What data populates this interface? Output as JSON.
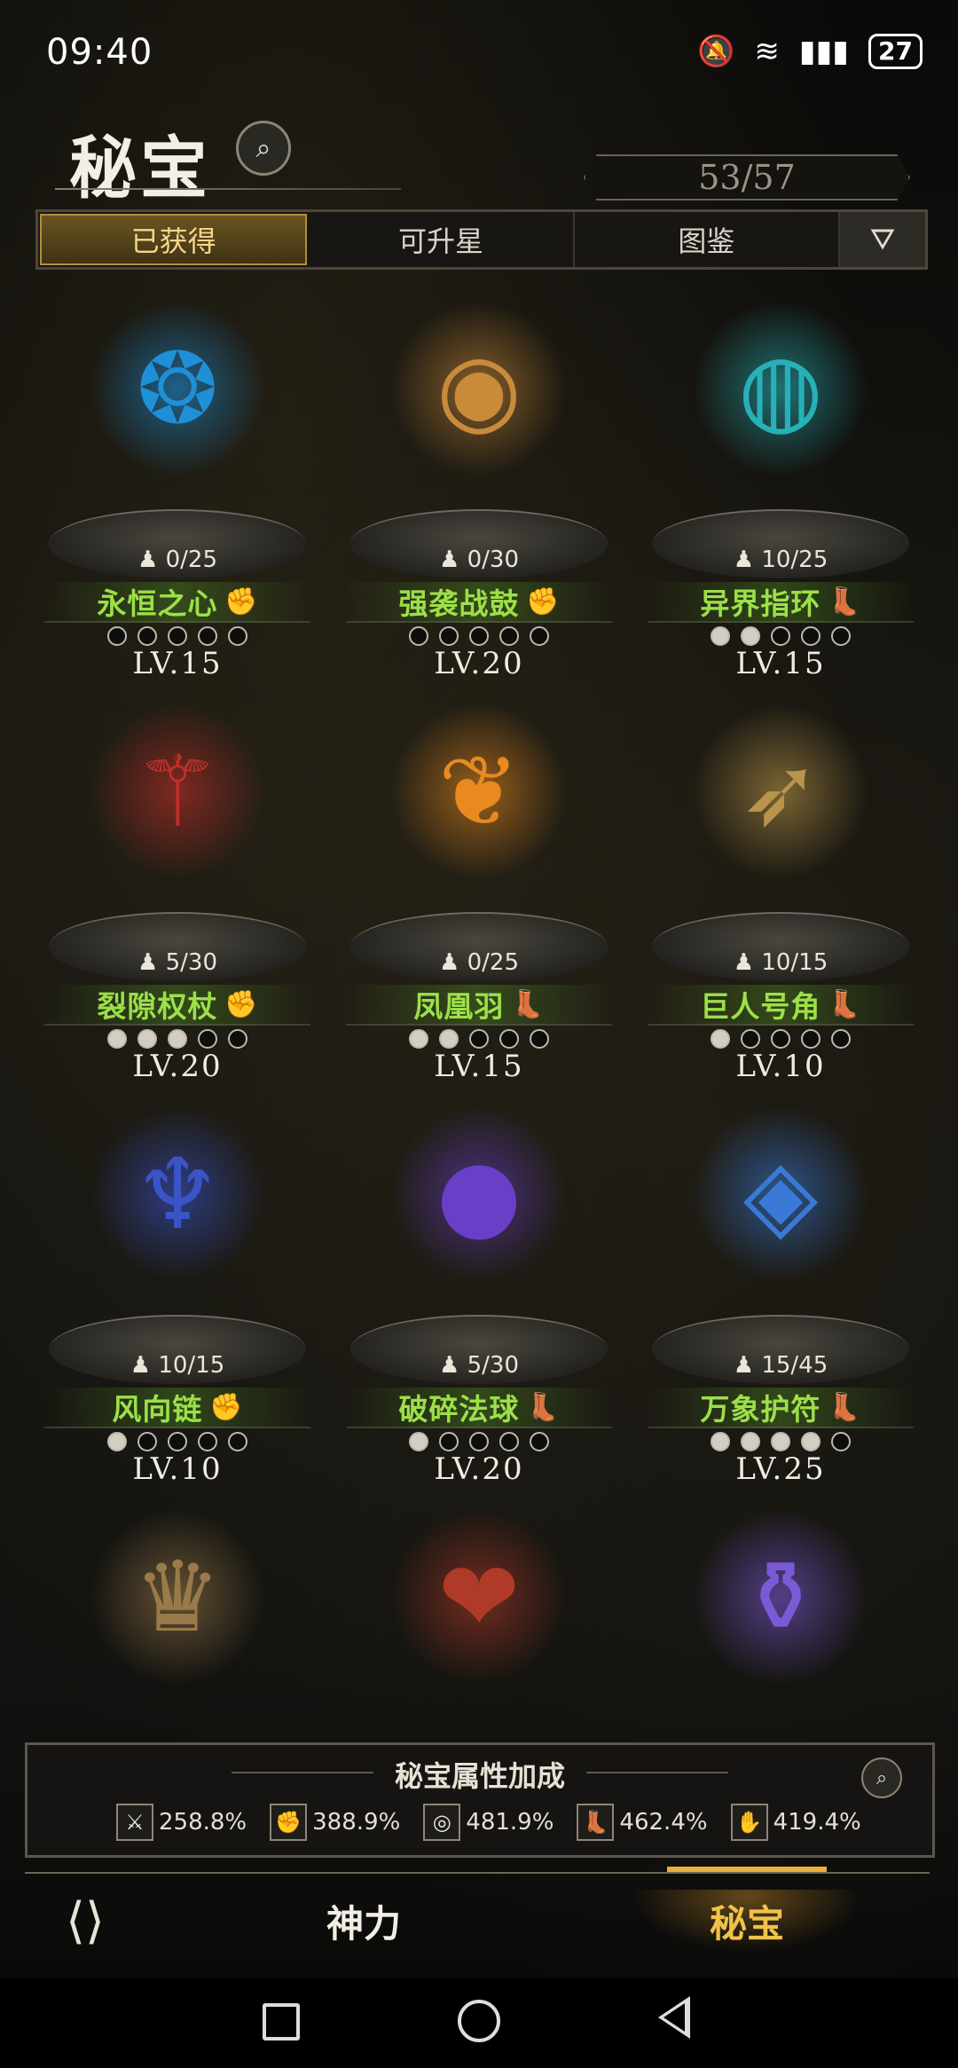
{
  "status_bar": {
    "time": "09:40",
    "battery": "27"
  },
  "header": {
    "title": "秘宝",
    "counter": "53/57"
  },
  "tabs": [
    {
      "label": "已获得",
      "active": true
    },
    {
      "label": "可升星",
      "active": false
    },
    {
      "label": "图鉴",
      "active": false
    }
  ],
  "items": [
    {
      "name": "永恒之心",
      "shards": "0/25",
      "level": "LV.15",
      "stars_on": 0,
      "icon": "heart-relic-icon",
      "type_icon": "fist-swirl-icon",
      "color": "#1f8fd6"
    },
    {
      "name": "强袭战鼓",
      "shards": "0/30",
      "level": "LV.20",
      "stars_on": 0,
      "icon": "war-drum-icon",
      "type_icon": "fist-swirl-icon",
      "color": "#c98a3a"
    },
    {
      "name": "异界指环",
      "shards": "10/25",
      "level": "LV.15",
      "stars_on": 2,
      "icon": "ring-icon",
      "type_icon": "boot-swirl-icon",
      "color": "#27b0b8"
    },
    {
      "name": "裂隙权杖",
      "shards": "5/30",
      "level": "LV.20",
      "stars_on": 3,
      "icon": "scepter-icon",
      "type_icon": "fist-swirl-icon",
      "color": "#c0302a"
    },
    {
      "name": "凤凰羽",
      "shards": "0/25",
      "level": "LV.15",
      "stars_on": 2,
      "icon": "feather-icon",
      "type_icon": "boot-icon",
      "color": "#e88a20"
    },
    {
      "name": "巨人号角",
      "shards": "10/15",
      "level": "LV.10",
      "stars_on": 1,
      "icon": "horn-icon",
      "type_icon": "boot-icon",
      "color": "#b8954a"
    },
    {
      "name": "风向链",
      "shards": "10/15",
      "level": "LV.10",
      "stars_on": 1,
      "icon": "necklace-icon",
      "type_icon": "fist-icon",
      "color": "#3a54c8"
    },
    {
      "name": "破碎法球",
      "shards": "5/30",
      "level": "LV.20",
      "stars_on": 1,
      "icon": "orb-icon",
      "type_icon": "boot-swirl-icon",
      "color": "#6a3fc8"
    },
    {
      "name": "万象护符",
      "shards": "15/45",
      "level": "LV.25",
      "stars_on": 4,
      "icon": "amulet-icon",
      "type_icon": "boot-swirl-icon",
      "color": "#3a7ad6"
    }
  ],
  "partial_items": [
    {
      "icon": "antler-crown-icon",
      "color": "#9a7a4a"
    },
    {
      "icon": "thorn-heart-icon",
      "color": "#b03a28"
    },
    {
      "icon": "potion-bottle-icon",
      "color": "#7a5ad6"
    }
  ],
  "bonus": {
    "title": "秘宝属性加成",
    "stats": [
      {
        "icon": "sword-icon",
        "value": "258.8%"
      },
      {
        "icon": "fist-icon",
        "value": "388.9%"
      },
      {
        "icon": "swirl-icon",
        "value": "481.9%"
      },
      {
        "icon": "boot-icon",
        "value": "462.4%"
      },
      {
        "icon": "claw-icon",
        "value": "419.4%"
      }
    ]
  },
  "bottom_nav": {
    "tabs": [
      "神力",
      "秘宝"
    ],
    "active": "秘宝"
  }
}
